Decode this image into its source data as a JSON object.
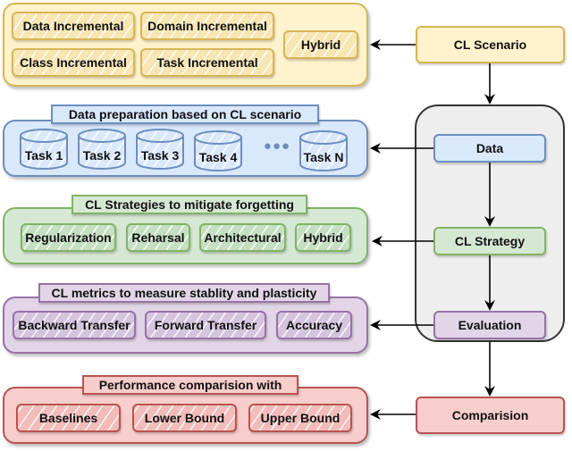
{
  "colors": {
    "yellow_fill": "#fff2cc",
    "yellow_stroke": "#d6b656",
    "blue_fill": "#dae8fc",
    "blue_stroke": "#6c8ebf",
    "green_fill": "#d5e8d4",
    "green_stroke": "#82b366",
    "purple_fill": "#e1d5e7",
    "purple_stroke": "#9673a6",
    "red_fill": "#f8cecc",
    "red_stroke": "#b85450",
    "container_fill": "#eeeeee",
    "arrow": "#000000"
  },
  "flow": {
    "scenario": "CL Scenario",
    "data": "Data",
    "strategy": "CL Strategy",
    "evaluation": "Evaluation",
    "comparison": "Comparision"
  },
  "scenario_group": {
    "items": [
      "Data Incremental",
      "Domain Incremental",
      "Class Incremental",
      "Task Incremental",
      "Hybrid"
    ]
  },
  "data_group": {
    "title": "Data preparation based on CL scenario",
    "tasks": [
      "Task 1",
      "Task 2",
      "Task 3",
      "Task 4",
      "Task N"
    ],
    "ellipsis": "●●●"
  },
  "strategy_group": {
    "title": "CL Strategies to mitigate forgetting",
    "items": [
      "Regularization",
      "Reharsal",
      "Architectural",
      "Hybrid"
    ]
  },
  "metrics_group": {
    "title": "CL metrics to measure stablity and plasticity",
    "items": [
      "Backward Transfer",
      "Forward Transfer",
      "Accuracy"
    ]
  },
  "comparison_group": {
    "title": "Performance comparision with",
    "items": [
      "Baselines",
      "Lower Bound",
      "Upper Bound"
    ]
  }
}
